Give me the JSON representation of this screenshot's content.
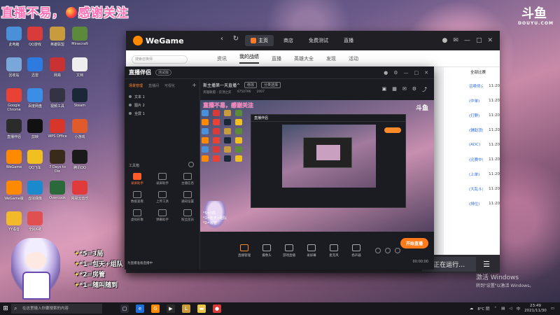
{
  "overlay": {
    "stream_title_a": "直播不易，",
    "stream_title_b": "感谢关注",
    "douyu_mark": "斗鱼",
    "douyu_sub": "DOUYU.COM"
  },
  "desktop_icons": [
    {
      "label": "此电脑",
      "icon": "computer-icon",
      "color": "#4a90d9"
    },
    {
      "label": "QQ游戏",
      "icon": "game-icon",
      "color": "#d93a3a"
    },
    {
      "label": "英雄联盟",
      "icon": "lol-icon",
      "color": "#c89b3c"
    },
    {
      "label": "Minecraft",
      "icon": "minecraft-icon",
      "color": "#5a8a3a"
    },
    {
      "label": "回收站",
      "icon": "recycle-bin-icon",
      "color": "#7aa7d9"
    },
    {
      "label": "迅雷",
      "icon": "thunder-icon",
      "color": "#2d7be0"
    },
    {
      "label": "网易",
      "icon": "netease-icon",
      "color": "#c83232"
    },
    {
      "label": "文档",
      "icon": "doc-icon",
      "color": "#eeeeee"
    },
    {
      "label": "Google Chrome",
      "icon": "chrome-icon",
      "color": "#e94235"
    },
    {
      "label": "百度网盘",
      "icon": "cloud-icon",
      "color": "#3a8ee6"
    },
    {
      "label": "视频工具",
      "icon": "video-icon",
      "color": "#333344"
    },
    {
      "label": "Steam",
      "icon": "steam-icon",
      "color": "#1b2838"
    },
    {
      "label": "直播伴侣",
      "icon": "live-icon",
      "color": "#2b2b2b"
    },
    {
      "label": "剪映",
      "icon": "capcut-icon",
      "color": "#111111"
    },
    {
      "label": "WPS Office",
      "icon": "wps-icon",
      "color": "#d9362b"
    },
    {
      "label": "小游戏",
      "icon": "minigame-icon",
      "color": "#e05a2a"
    },
    {
      "label": "WeGame",
      "icon": "wegame-icon",
      "color": "#ff8a00"
    },
    {
      "label": "QQ飞车",
      "icon": "qqcar-icon",
      "color": "#f0c020"
    },
    {
      "label": "7 Days to Die",
      "icon": "7days-icon",
      "color": "#3a2a1a"
    },
    {
      "label": "腾讯QQ",
      "icon": "qq-icon",
      "color": "#1a1a1a"
    },
    {
      "label": "WeGame版",
      "icon": "wegame-icon",
      "color": "#ff8a00"
    },
    {
      "label": "虚拟偶像",
      "icon": "vtuber-icon",
      "color": "#1a8acc"
    },
    {
      "label": "Overcook",
      "icon": "overcook-icon",
      "color": "#2a6a3a"
    },
    {
      "label": "网易云音乐",
      "icon": "music-icon",
      "color": "#e03a3a"
    },
    {
      "label": "YY语音",
      "icon": "yy-icon",
      "color": "#f2b92a"
    },
    {
      "label": "全民K歌",
      "icon": "ksong-icon",
      "color": "#e05050"
    }
  ],
  "wegame": {
    "logo": "WeGame",
    "tabs": [
      "主页",
      "商店",
      "免费测试",
      "直播"
    ],
    "subnav": [
      "资讯",
      "我的战绩",
      "直播",
      "英雄大全",
      "发现",
      "活动"
    ],
    "search_placeholder": "搜索召唤师",
    "side_header": "全部比赛",
    "side_rows": [
      {
        "name": "召唤师(高顶)",
        "time": "11:20"
      },
      {
        "name": "(中单)",
        "time": "11:20"
      },
      {
        "name": "(打野)",
        "time": "11:20"
      },
      {
        "name": "(辅助顶)",
        "time": "11:20"
      },
      {
        "name": "(ADC)",
        "time": "11:20"
      },
      {
        "name": "(比赛中)",
        "time": "11:20"
      },
      {
        "name": "(上单)",
        "time": "11:20"
      },
      {
        "name": "(大乱斗)",
        "time": "11:20"
      },
      {
        "name": "(排位)",
        "time": "11:20"
      }
    ],
    "running_label": "正在运行…"
  },
  "streamer": {
    "brand": "直播伴侣",
    "version": "测试版",
    "scene_tabs": [
      "场景管理",
      "直播间",
      "可视化"
    ],
    "scenes": [
      "文本 1",
      "图片 2",
      "全屏 1"
    ],
    "tools_label": "工具箱",
    "tools": [
      {
        "label": "录屏助手",
        "hot": true
      },
      {
        "label": "录屏助手",
        "hot": false
      },
      {
        "label": "主播信息",
        "hot": false
      },
      {
        "label": "数据查看",
        "hot": false
      },
      {
        "label": "上传工具",
        "hot": false
      },
      {
        "label": "通知设置",
        "hot": false
      },
      {
        "label": "虚拟形象",
        "hot": false
      },
      {
        "label": "弹幕助手",
        "hot": false
      },
      {
        "label": "粉丝团员",
        "hot": false
      }
    ],
    "room_title": "斯主播第一天直播^",
    "room_tag": "修改",
    "room_category": "分类选择",
    "meta": [
      "英雄联盟 - 云顶之弈",
      "4750796",
      "2007"
    ],
    "preview_title": "直播不易，感谢关注",
    "preview_logo": "斗鱼",
    "preview_lines": [
      "*5=3局",
      "*1=包天+组队",
      "*2=房管"
    ],
    "actions": [
      "直播管理",
      "摄像头",
      "游戏直播",
      "录屏幕",
      "麦克风",
      "扬声器"
    ],
    "start_label": "开始直播",
    "timer": "00:00:00",
    "status": "为直播准备直播中"
  },
  "rules": [
    {
      "text": "*5=3局"
    },
    {
      "text": "*1=包天+组队"
    },
    {
      "text": "*2=房管"
    },
    {
      "text": "*1=随叫随到"
    }
  ],
  "watermark": {
    "line1": "激活 Windows",
    "line2": "转到\"设置\"以激活 Windows。"
  },
  "taskbar": {
    "search_placeholder": "在这里输入你要搜索的内容",
    "temp": "8°C 阴",
    "lang": "中",
    "time": "23:49",
    "date": "2021/11/30"
  }
}
